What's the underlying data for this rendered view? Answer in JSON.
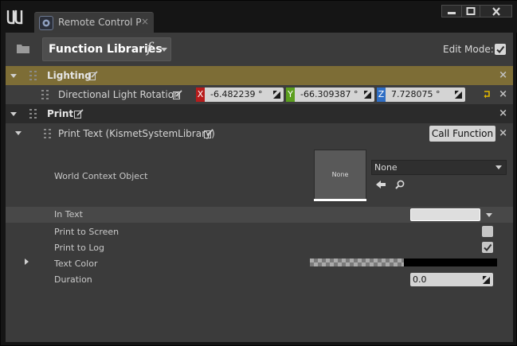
{
  "window": {
    "tab_title": "Remote Control P",
    "tab_close": "×",
    "controls": [
      "minimize",
      "maximize",
      "close"
    ]
  },
  "toolbar": {
    "function_libraries_label": "Function Libraries",
    "function_glyph": "f",
    "edit_mode_label": "Edit Mode:",
    "edit_mode_checked": true
  },
  "sections": {
    "lighting": {
      "title": "Lighting",
      "color": "#7d6d36",
      "rows": {
        "directional_light_rotation": {
          "label": "Directional Light Rotation",
          "x": "-6.482239 °",
          "y": "-66.309387 °",
          "z": "7.728075 °"
        }
      }
    },
    "print": {
      "title": "Print",
      "function_row": {
        "label": "Print Text (KismetSystemLibrary)",
        "call_button": "Call Function"
      },
      "params": {
        "world_context_object": {
          "label": "World Context Object",
          "thumb_text": "None",
          "combo_value": "None"
        },
        "in_text": {
          "label": "In Text",
          "value": ""
        },
        "print_to_screen": {
          "label": "Print to Screen",
          "checked": false
        },
        "print_to_log": {
          "label": "Print to Log",
          "checked": true
        },
        "text_color": {
          "label": "Text Color",
          "color": "#000000"
        },
        "duration": {
          "label": "Duration",
          "value": "0.0"
        }
      }
    }
  },
  "icons": {
    "remove": "×",
    "axis_x": "X",
    "axis_y": "Y",
    "axis_z": "Z"
  },
  "colors": {
    "axis_x": "#b71c1c",
    "axis_y": "#5b9e1e",
    "axis_z": "#2f6ec4",
    "reset_arrow": "#e2b800"
  }
}
